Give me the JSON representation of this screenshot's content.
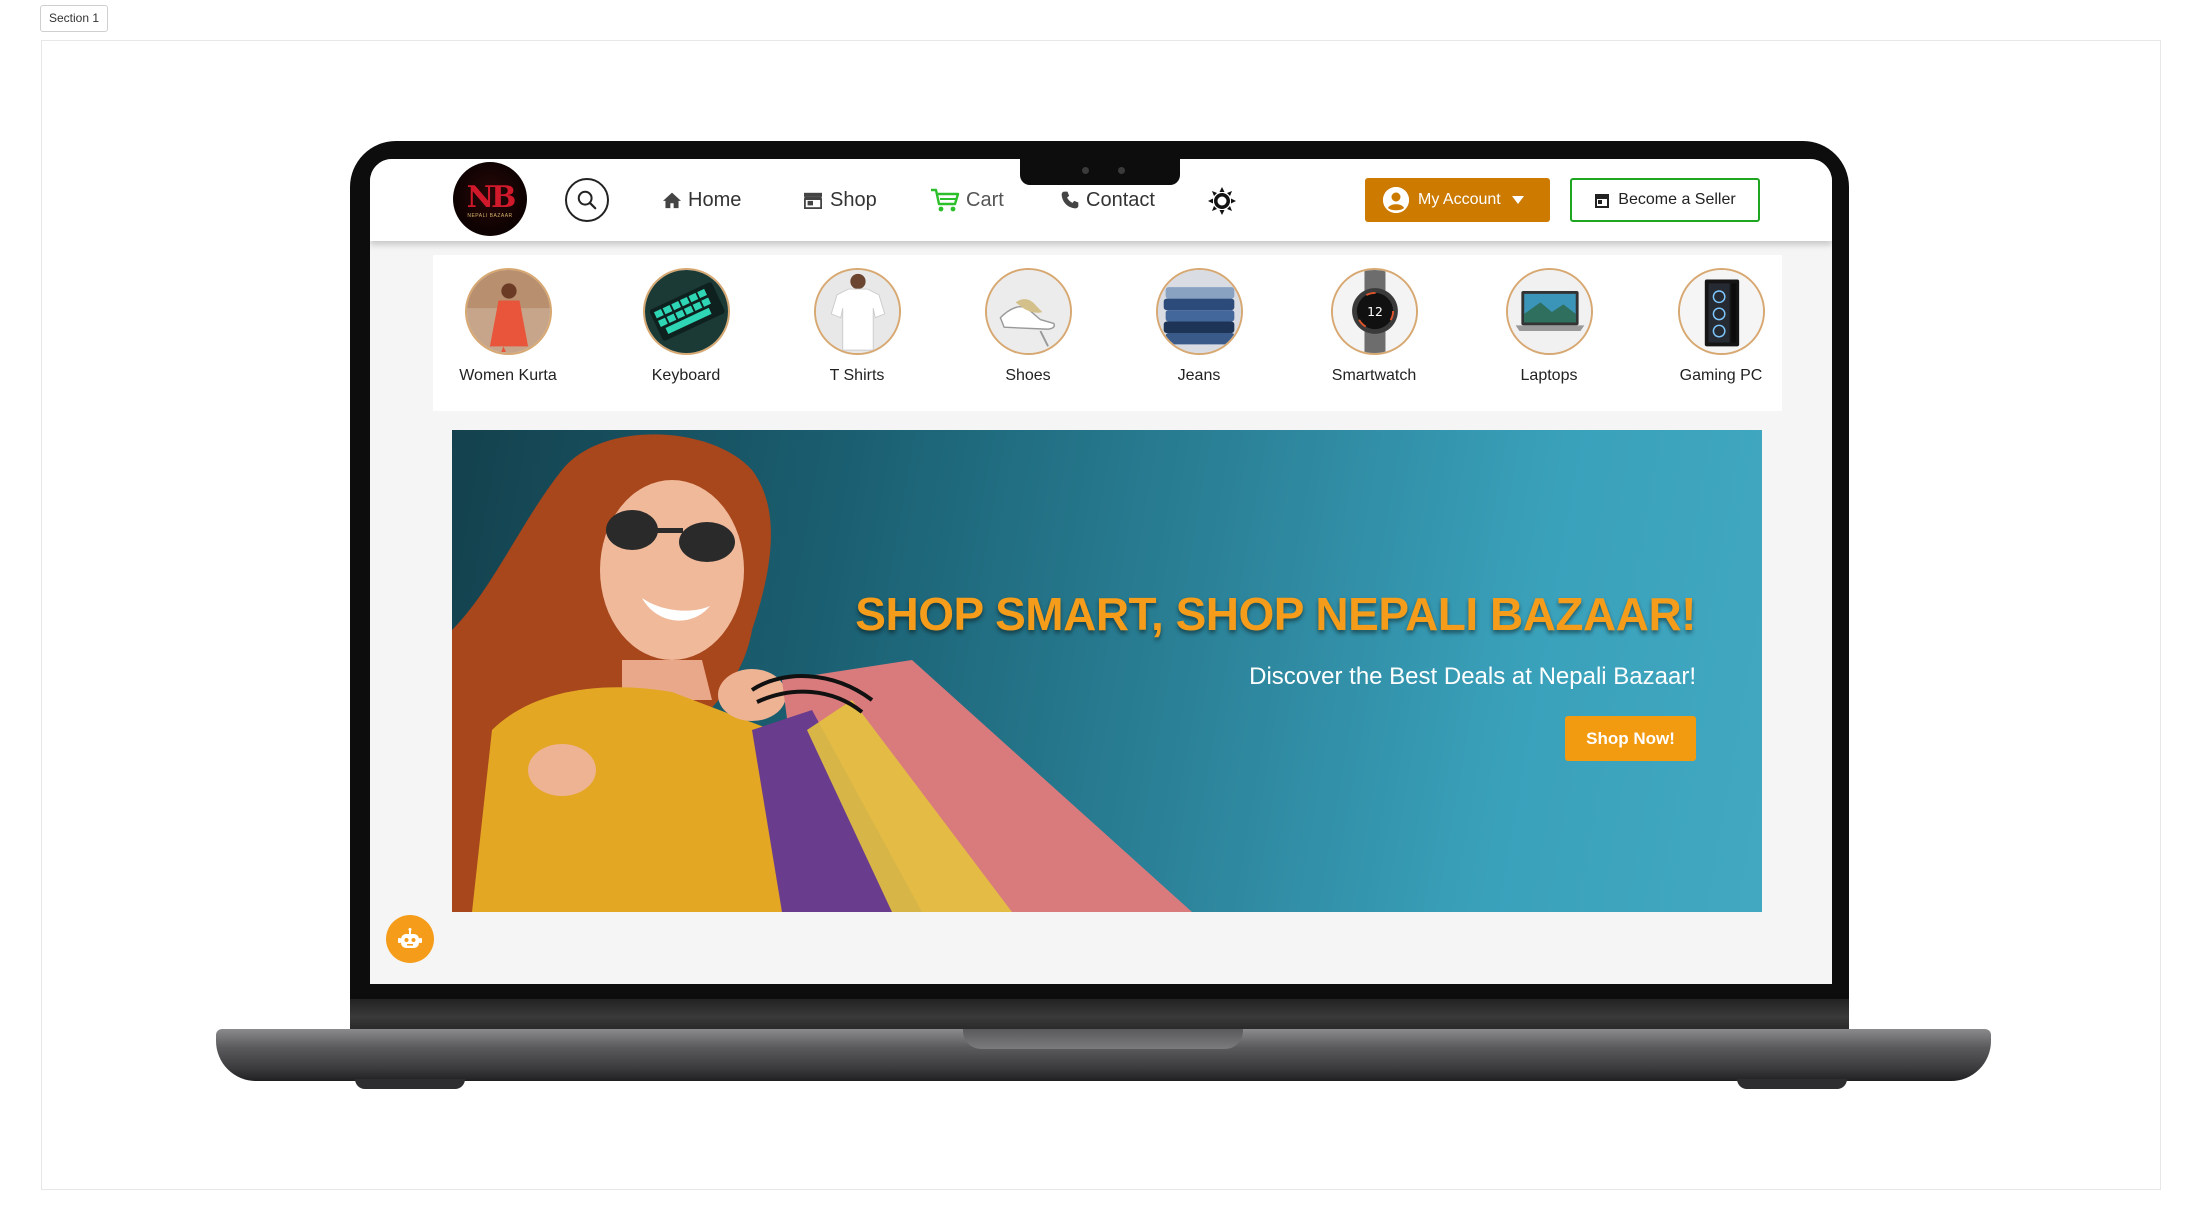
{
  "section_label": "Section 1",
  "nav": {
    "home": "Home",
    "shop": "Shop",
    "cart": "Cart",
    "contact": "Contact",
    "account": "My Account",
    "seller": "Become a Seller",
    "logo_mark": "NB",
    "logo_sub": "NEPALI BAZAAR"
  },
  "categories": [
    {
      "label": "Women Kurta",
      "icon": "women-kurta"
    },
    {
      "label": "Keyboard",
      "icon": "keyboard"
    },
    {
      "label": "T Shirts",
      "icon": "t-shirt"
    },
    {
      "label": "Shoes",
      "icon": "shoes"
    },
    {
      "label": "Jeans",
      "icon": "jeans"
    },
    {
      "label": "Smartwatch",
      "icon": "smartwatch"
    },
    {
      "label": "Laptops",
      "icon": "laptop"
    },
    {
      "label": "Gaming PC",
      "icon": "gaming-pc"
    }
  ],
  "banner": {
    "headline": "SHOP SMART, SHOP NEPALI BAZAAR!",
    "subtitle": "Discover the Best Deals at Nepali Bazaar!",
    "cta": "Shop Now!"
  },
  "colors": {
    "accent": "#f59d1b",
    "account_button": "#cc7a00",
    "seller_border": "#1fa51f",
    "cart_icon": "#2bc02b",
    "banner_teal": "#2a8096"
  }
}
